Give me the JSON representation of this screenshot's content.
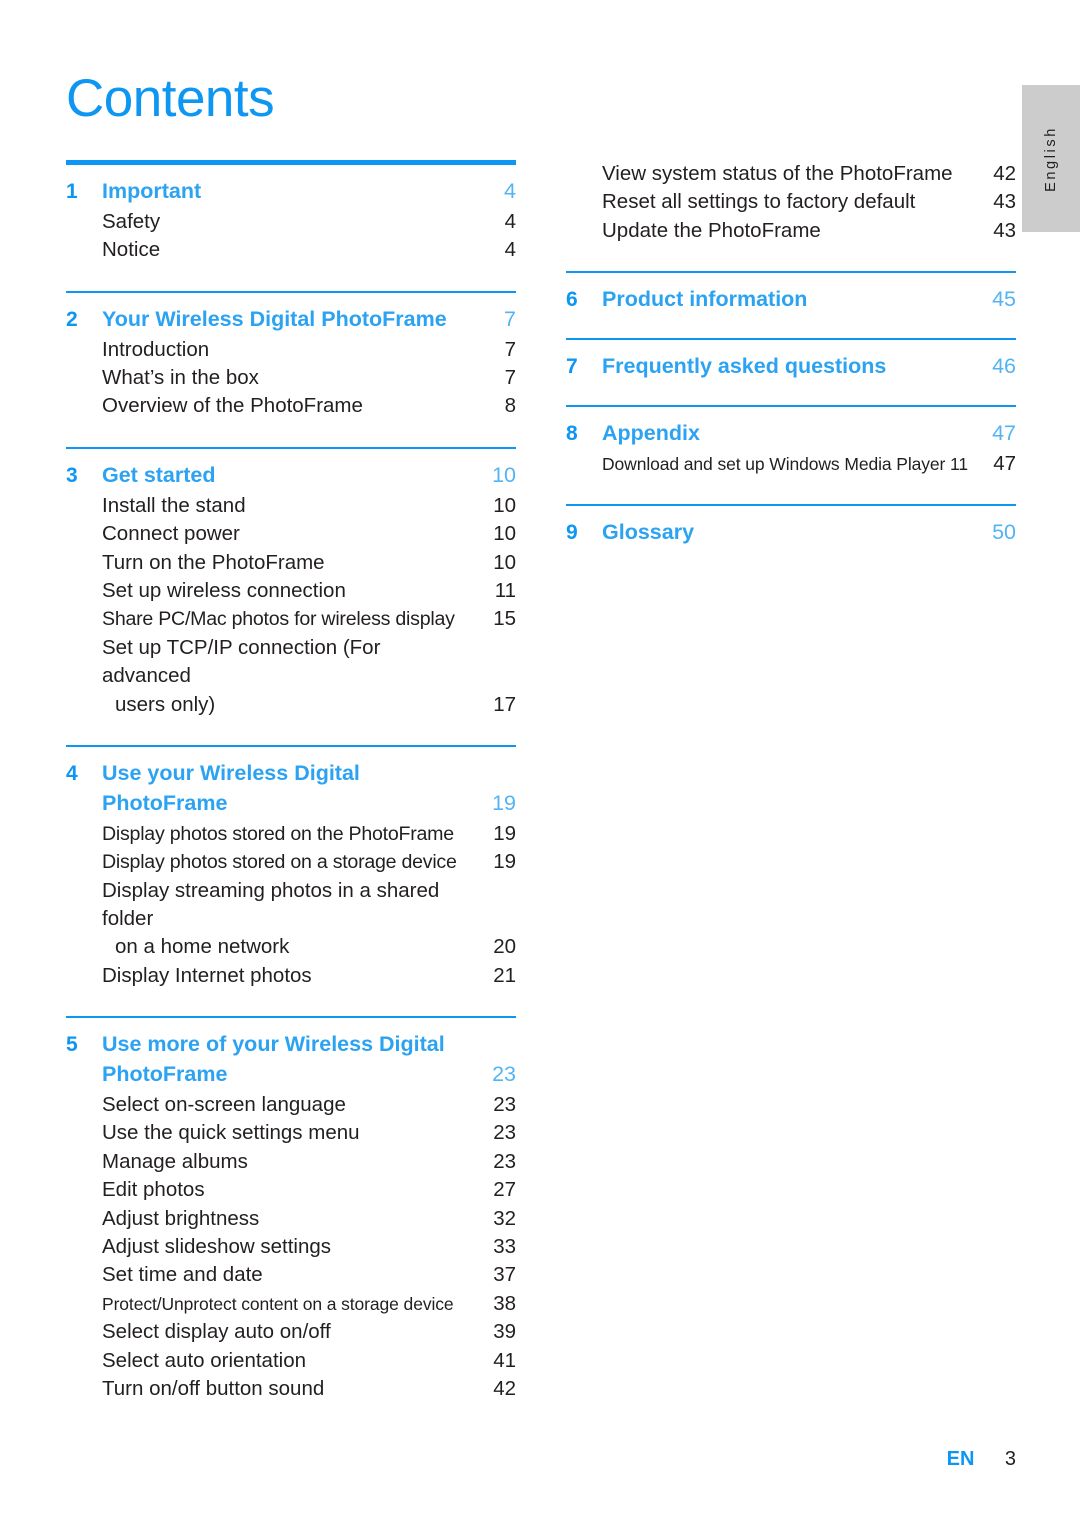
{
  "document": {
    "title": "Contents",
    "language_tab": "English",
    "footer": {
      "locale": "EN",
      "page_number": "3"
    }
  },
  "colors": {
    "accent_blue": "#0d96f2",
    "chapter_blue": "#2ba3f2",
    "page_blue": "#53b4f4",
    "body_text": "#231f20",
    "tab_background": "#cccccc"
  },
  "left_column": [
    {
      "number": "1",
      "title": "Important",
      "page": "4",
      "entries": [
        {
          "label": "Safety",
          "page": "4"
        },
        {
          "label": "Notice",
          "page": "4"
        }
      ]
    },
    {
      "number": "2",
      "title": "Your Wireless Digital PhotoFrame",
      "page": "7",
      "entries": [
        {
          "label": "Introduction",
          "page": "7"
        },
        {
          "label": "What’s in the box",
          "page": "7"
        },
        {
          "label": "Overview of the PhotoFrame",
          "page": "8"
        }
      ]
    },
    {
      "number": "3",
      "title": "Get started",
      "page": "10",
      "entries": [
        {
          "label": "Install the stand",
          "page": "10"
        },
        {
          "label": "Connect power",
          "page": "10"
        },
        {
          "label": "Turn on the PhotoFrame",
          "page": "10"
        },
        {
          "label": "Set up wireless connection",
          "page": "11"
        },
        {
          "label": "Share PC/Mac photos for wireless display",
          "page": "15"
        },
        {
          "label": "Set up TCP/IP connection (For advanced",
          "page": ""
        },
        {
          "label": "users only)",
          "page": "17"
        }
      ]
    },
    {
      "number": "4",
      "title_line1": "Use your Wireless Digital",
      "title_line2": "PhotoFrame",
      "page": "19",
      "entries": [
        {
          "label": "Display photos stored on the PhotoFrame",
          "page": "19"
        },
        {
          "label": "Display photos stored on a storage device",
          "page": "19"
        },
        {
          "label": "Display streaming photos in a shared folder",
          "page": ""
        },
        {
          "label": "on a home network",
          "page": "20"
        },
        {
          "label": "Display Internet photos",
          "page": "21"
        }
      ]
    },
    {
      "number": "5",
      "title_line1": "Use more of your Wireless Digital",
      "title_line2": "PhotoFrame",
      "page": "23",
      "entries": [
        {
          "label": "Select on-screen language",
          "page": "23"
        },
        {
          "label": "Use the quick settings menu",
          "page": "23"
        },
        {
          "label": "Manage albums",
          "page": "23"
        },
        {
          "label": "Edit photos",
          "page": "27"
        },
        {
          "label": "Adjust brightness",
          "page": "32"
        },
        {
          "label": "Adjust slideshow settings",
          "page": "33"
        },
        {
          "label": "Set time and date",
          "page": "37"
        },
        {
          "label": "Protect/Unprotect content on a storage device",
          "page": "38"
        },
        {
          "label": "Select display auto on/off",
          "page": "39"
        },
        {
          "label": "Select auto orientation",
          "page": "41"
        },
        {
          "label": "Turn on/off button sound",
          "page": "42"
        }
      ]
    }
  ],
  "right_column": {
    "continued_entries": [
      {
        "label": "View system status of the PhotoFrame",
        "page": "42"
      },
      {
        "label": "Reset all settings to factory default",
        "page": "43"
      },
      {
        "label": "Update the PhotoFrame",
        "page": "43"
      }
    ],
    "chapters": [
      {
        "number": "6",
        "title": "Product information",
        "page": "45",
        "entries": []
      },
      {
        "number": "7",
        "title": "Frequently asked questions",
        "page": "46",
        "entries": []
      },
      {
        "number": "8",
        "title": "Appendix",
        "page": "47",
        "entries": [
          {
            "label": "Download and set up Windows Media Player 11",
            "page": "47"
          }
        ]
      },
      {
        "number": "9",
        "title": "Glossary",
        "page": "50",
        "entries": []
      }
    ]
  }
}
